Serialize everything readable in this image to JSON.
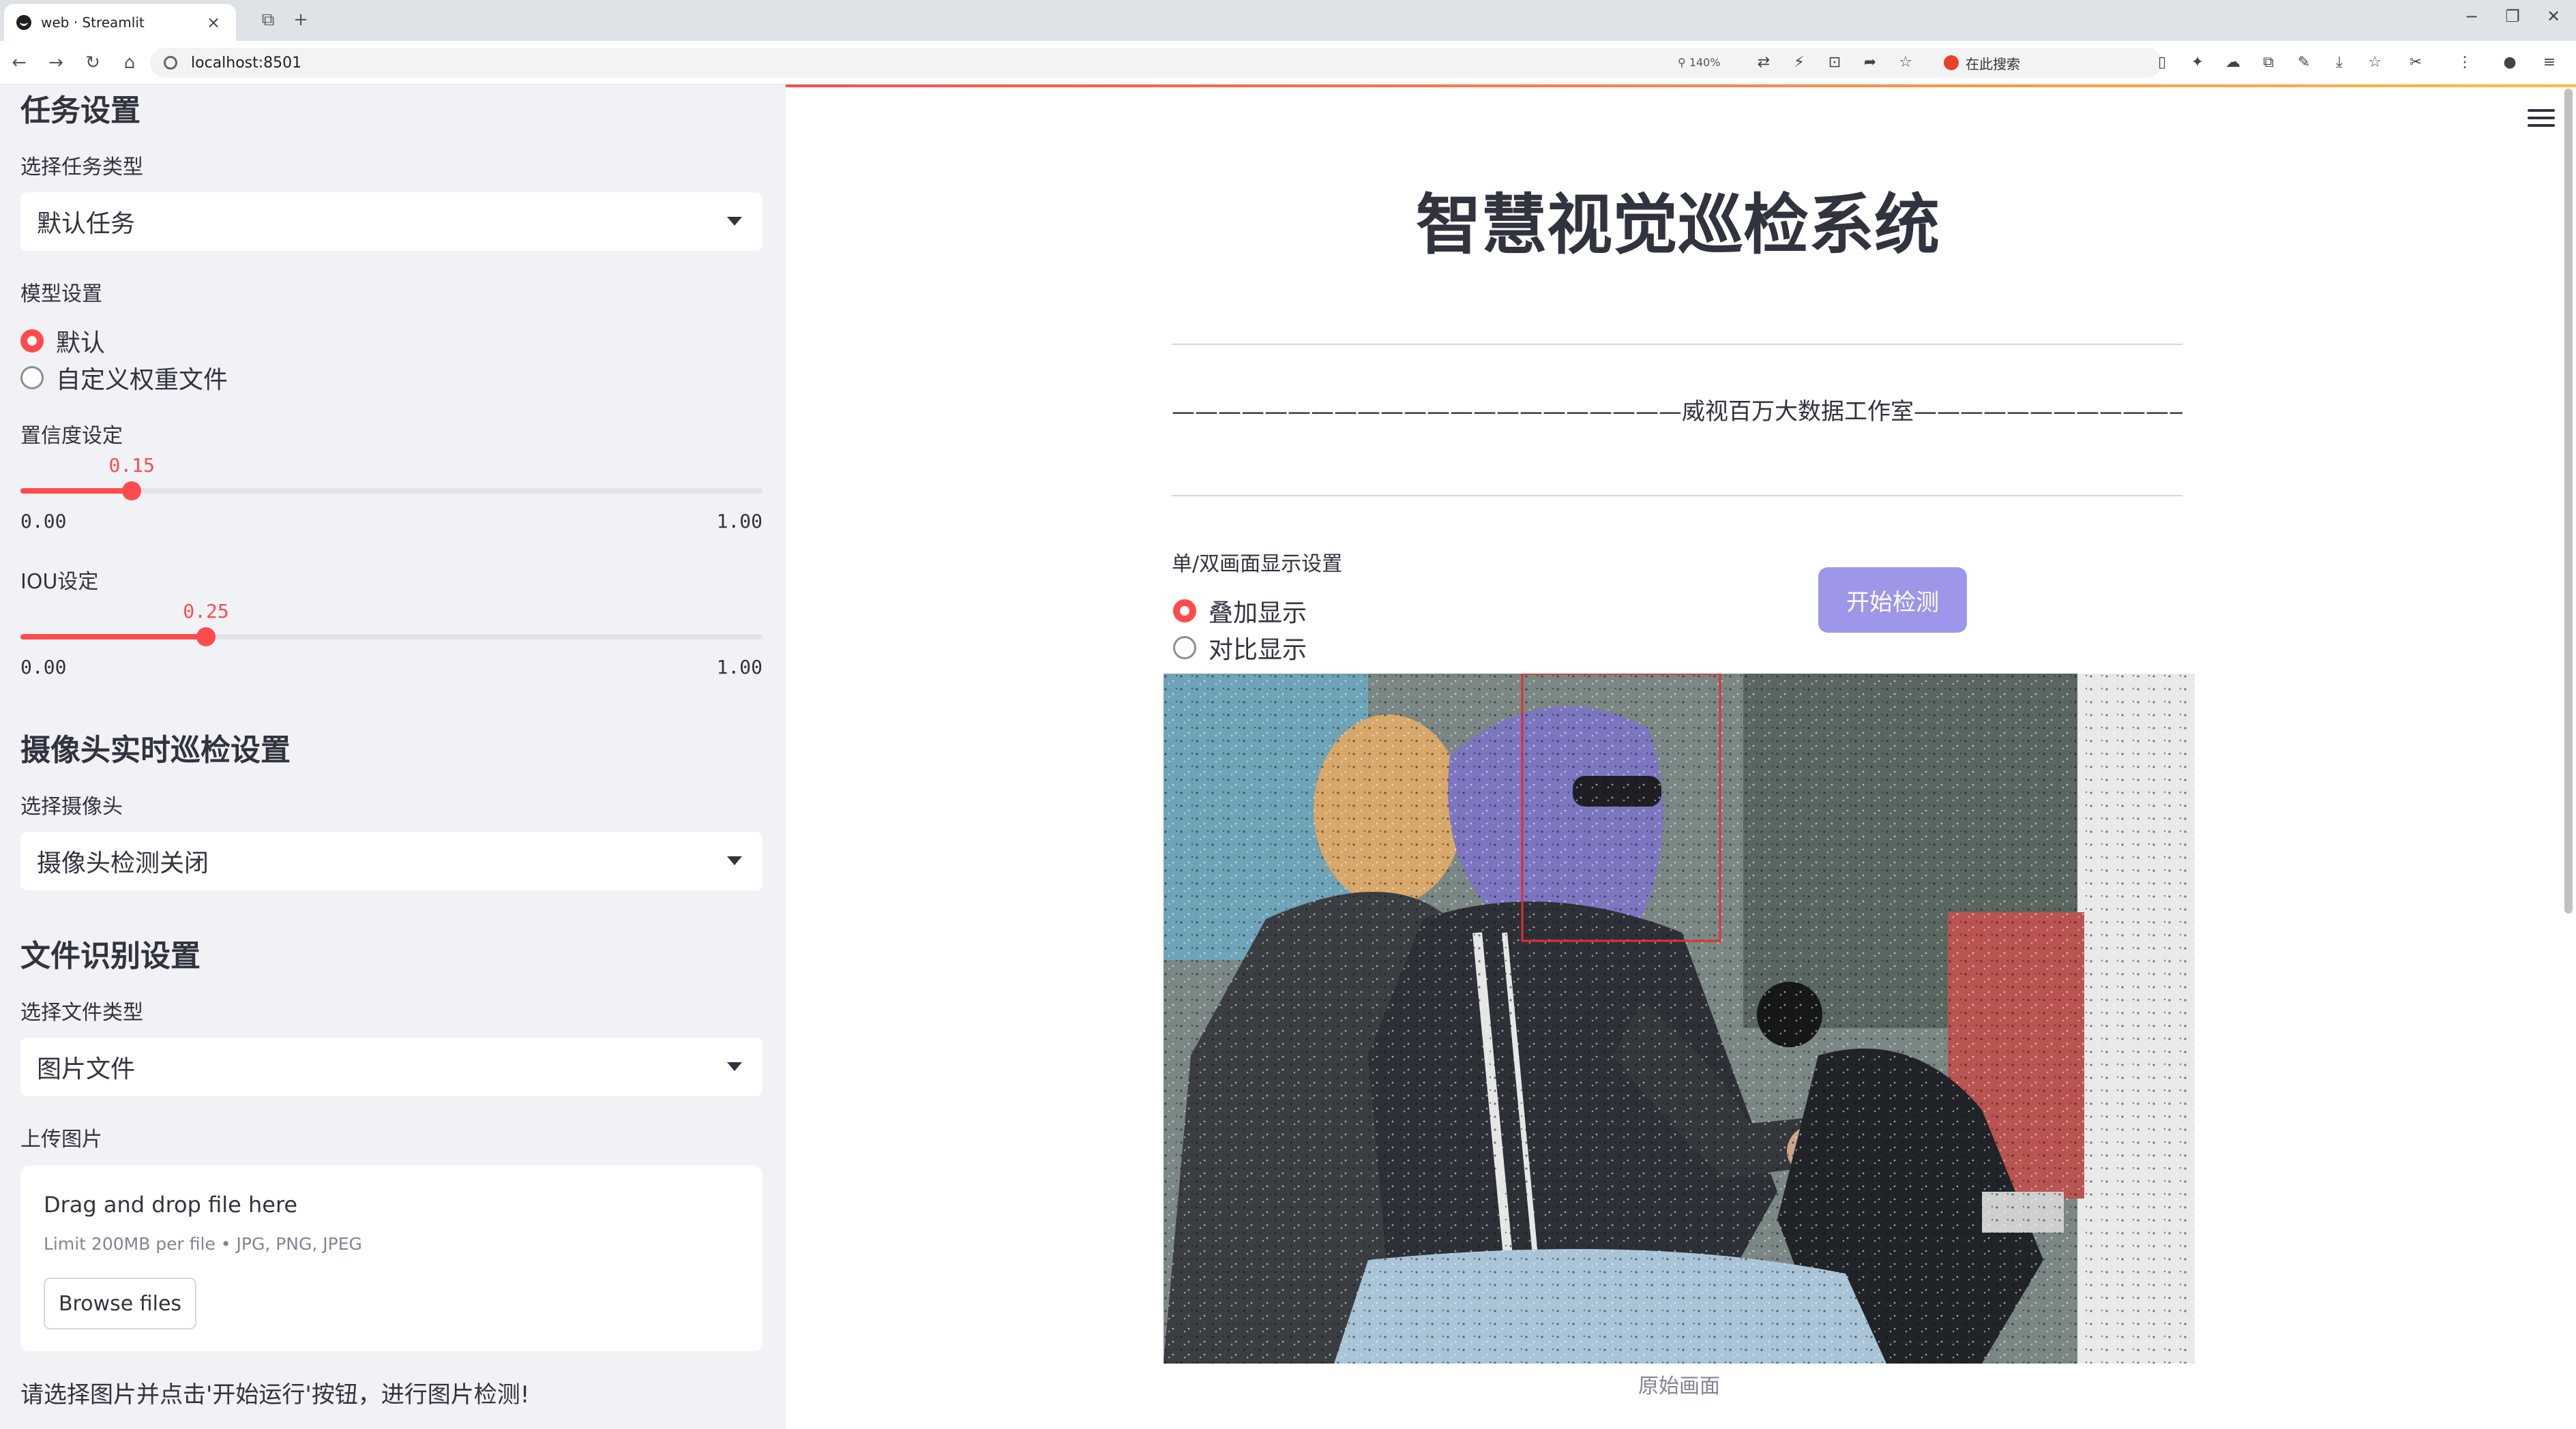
{
  "browser": {
    "tab_title": "web · Streamlit",
    "url": "localhost:8501",
    "zoom": "140%",
    "search_placeholder": "在此搜索"
  },
  "sidebar": {
    "task_section_title": "任务设置",
    "task_type_label": "选择任务类型",
    "task_type_value": "默认任务",
    "model_label": "模型设置",
    "model_options": [
      "默认",
      "自定义权重文件"
    ],
    "model_selected": "默认",
    "confidence_label": "置信度设定",
    "confidence": {
      "value": 0.15,
      "value_text": "0.15",
      "min_text": "0.00",
      "max_text": "1.00"
    },
    "iou_label": "IOU设定",
    "iou": {
      "value": 0.25,
      "value_text": "0.25",
      "min_text": "0.00",
      "max_text": "1.00"
    },
    "camera_section_title": "摄像头实时巡检设置",
    "camera_label": "选择摄像头",
    "camera_value": "摄像头检测关闭",
    "file_section_title": "文件识别设置",
    "file_type_label": "选择文件类型",
    "file_type_value": "图片文件",
    "upload_label": "上传图片",
    "upload_title": "Drag and drop file here",
    "upload_limit": "Limit 200MB per file • JPG, PNG, JPEG",
    "browse_label": "Browse files",
    "hint": "请选择图片并点击'开始运行'按钮，进行图片检测!"
  },
  "main": {
    "title": "智慧视觉巡检系统",
    "subtitle": "——————————————————————威视百万大数据工作室————————————————————————",
    "display_label": "单/双画面显示设置",
    "display_options": [
      "叠加显示",
      "对比显示"
    ],
    "display_selected": "叠加显示",
    "start_button": "开始检测",
    "image_caption": "原始画面"
  },
  "colors": {
    "accent": "#ff4b4b",
    "button": "#9e96e8",
    "sidebar_bg": "#f0f2f6",
    "detection_box": "#e03030"
  }
}
